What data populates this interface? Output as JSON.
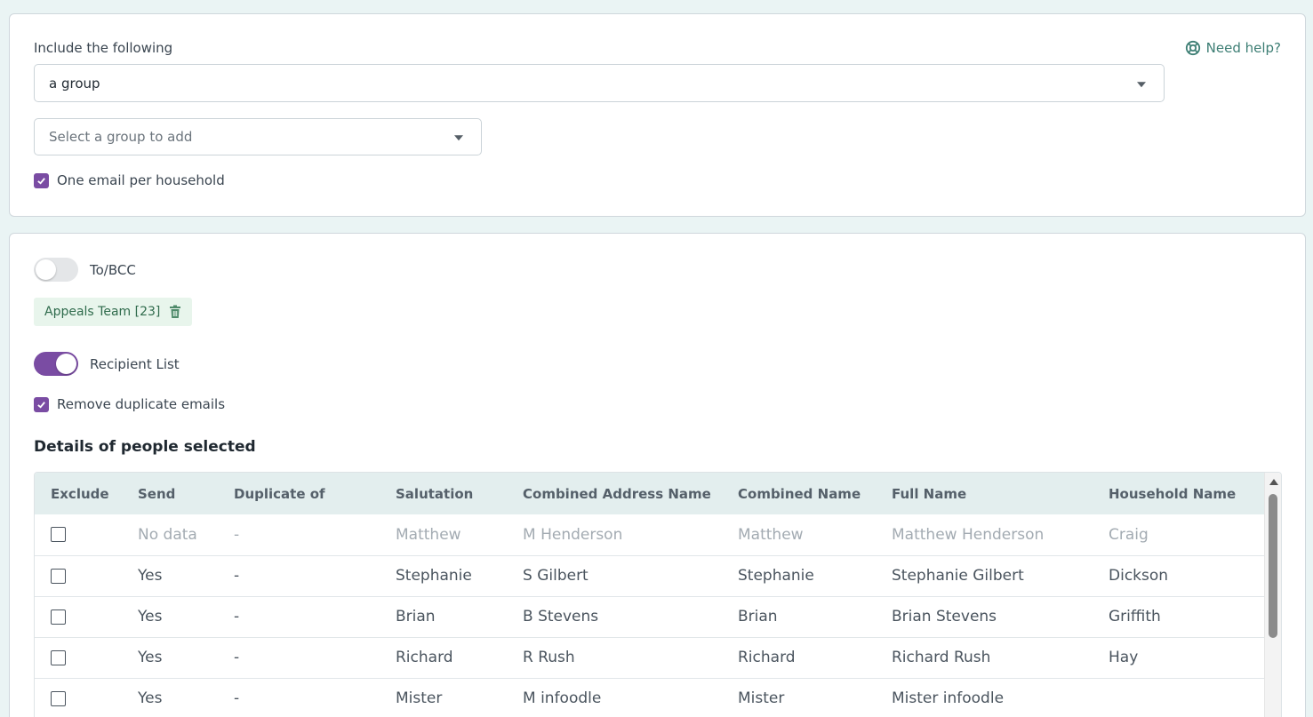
{
  "include": {
    "label": "Include the following",
    "selected": "a group",
    "help_label": "Need help?",
    "group_select_placeholder": "Select a group to add",
    "one_email_label": "One email per household",
    "one_email_checked": true
  },
  "recipients": {
    "to_bcc_label": "To/BCC",
    "to_bcc_on": false,
    "group_chip": "Appeals Team [23]",
    "recipient_list_label": "Recipient List",
    "recipient_list_on": true,
    "remove_duplicates_label": "Remove duplicate emails",
    "remove_duplicates_checked": true,
    "details_title": "Details of people selected"
  },
  "table": {
    "columns": [
      "Exclude",
      "Send",
      "Duplicate of",
      "Salutation",
      "Combined Address Name",
      "Combined Name",
      "Full Name",
      "Household Name"
    ],
    "rows": [
      {
        "send": "No data",
        "duplicate": "-",
        "salutation": "Matthew",
        "address_name": "M Henderson",
        "combined_name": "Matthew",
        "full_name": "Matthew Henderson",
        "household": "Craig",
        "muted": true
      },
      {
        "send": "Yes",
        "duplicate": "-",
        "salutation": "Stephanie",
        "address_name": "S Gilbert",
        "combined_name": "Stephanie",
        "full_name": "Stephanie Gilbert",
        "household": "Dickson",
        "muted": false
      },
      {
        "send": "Yes",
        "duplicate": "-",
        "salutation": "Brian",
        "address_name": "B Stevens",
        "combined_name": "Brian",
        "full_name": "Brian Stevens",
        "household": "Griffith",
        "muted": false
      },
      {
        "send": "Yes",
        "duplicate": "-",
        "salutation": "Richard",
        "address_name": "R Rush",
        "combined_name": "Richard",
        "full_name": "Richard Rush",
        "household": "Hay",
        "muted": false
      },
      {
        "send": "Yes",
        "duplicate": "-",
        "salutation": "Mister",
        "address_name": "M infoodle",
        "combined_name": "Mister",
        "full_name": "Mister infoodle",
        "household": "",
        "muted": false
      }
    ]
  },
  "colors": {
    "accent": "#7a4ca3",
    "help_link": "#3d7e74",
    "chip_bg": "#e8f5ec",
    "table_header_bg": "#e3eeee"
  }
}
